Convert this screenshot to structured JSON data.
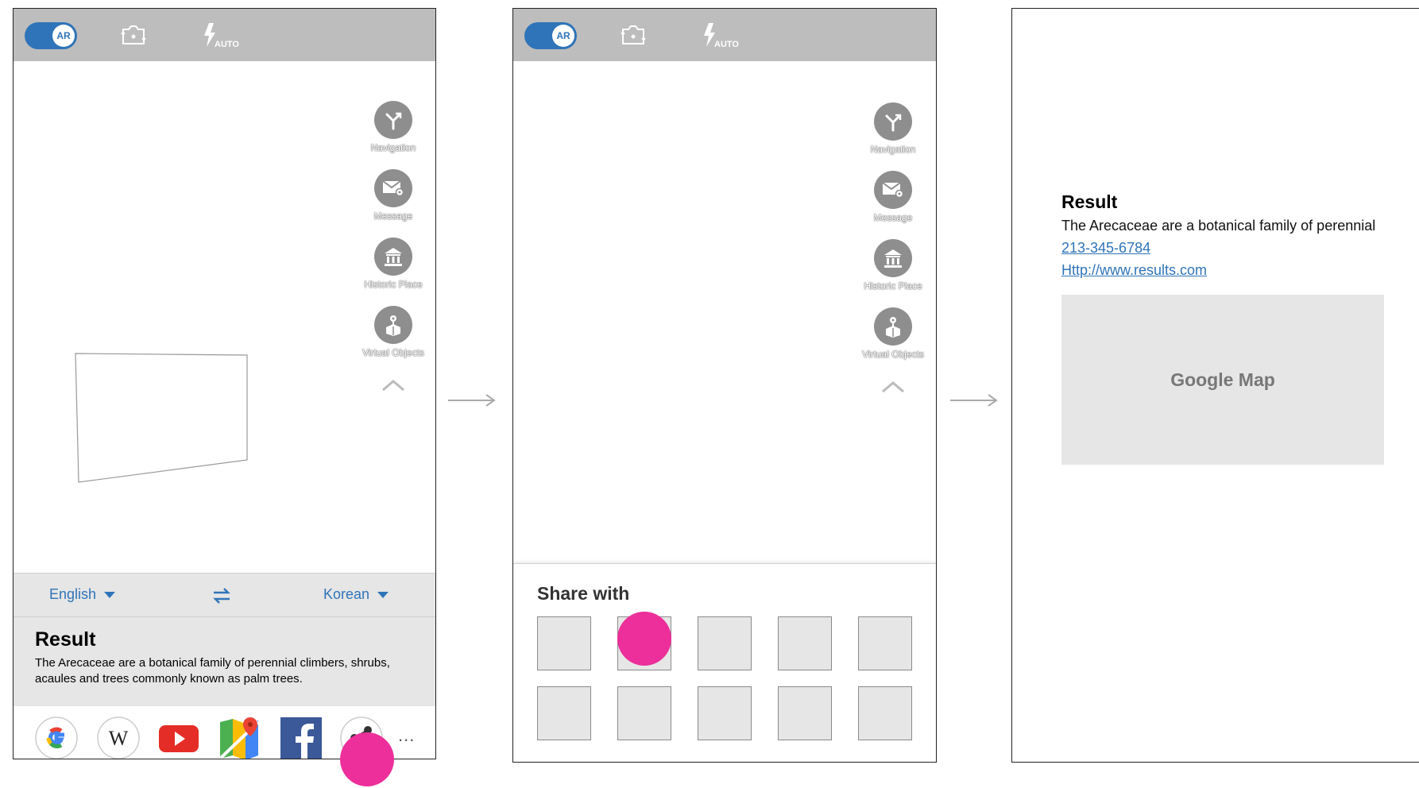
{
  "phone1": {
    "topbar": {
      "ar_label": "AR",
      "flash_mode": "AUTO"
    },
    "rail": [
      {
        "label": "Navigation",
        "icon": "navigation-fork-icon"
      },
      {
        "label": "Message",
        "icon": "message-envelope-icon"
      },
      {
        "label": "Historic Place",
        "icon": "historic-building-icon"
      },
      {
        "label": "Virtual Objects",
        "icon": "virtual-objects-icon"
      }
    ],
    "languages": {
      "source": "English",
      "target": "Korean"
    },
    "result": {
      "title": "Result",
      "text": "The Arecaceae are a botanical family of perennial climbers, shrubs, acaules and trees commonly known as palm trees."
    },
    "share_apps": [
      "google-icon",
      "wikipedia-icon",
      "youtube-icon",
      "google-maps-icon",
      "facebook-icon",
      "share-icon"
    ],
    "more": "..."
  },
  "phone2": {
    "topbar": {
      "ar_label": "AR",
      "flash_mode": "AUTO"
    },
    "rail": [
      {
        "label": "Navigation",
        "icon": "navigation-fork-icon"
      },
      {
        "label": "Message",
        "icon": "message-envelope-icon"
      },
      {
        "label": "Historic Place",
        "icon": "historic-building-icon"
      },
      {
        "label": "Virtual Objects",
        "icon": "virtual-objects-icon"
      }
    ],
    "share_sheet": {
      "title": "Share with",
      "slot_count": 10
    }
  },
  "phone3": {
    "result": {
      "title": "Result",
      "text": "The Arecaceae are a botanical family of perennial",
      "phone": "213-345-6784",
      "url": "Http://www.results.com"
    },
    "map_label": "Google Map"
  },
  "colors": {
    "accent_blue": "#2f74b8",
    "tap_marker": "#ec2f9a",
    "topbar_gray": "#bdbdbd",
    "panel_gray": "#e6e6e6"
  }
}
